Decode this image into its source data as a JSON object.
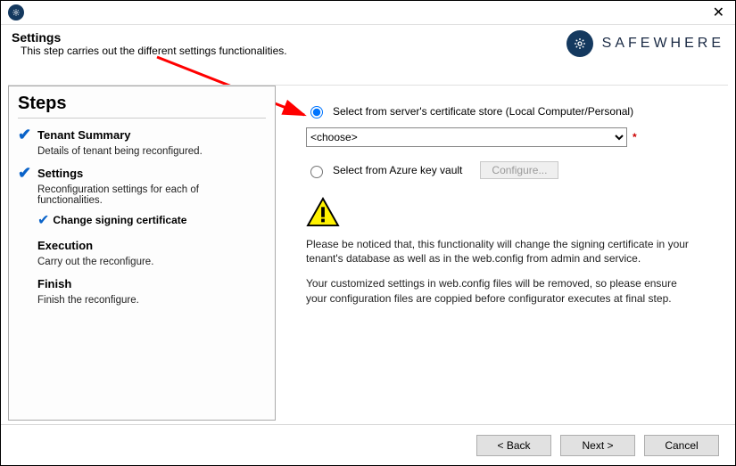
{
  "header": {
    "title": "Settings",
    "subtitle": "This step carries out the different settings functionalities.",
    "brand": "SAFEWHERE"
  },
  "sidebar": {
    "heading": "Steps",
    "steps": [
      {
        "title": "Tenant Summary",
        "desc": "Details of tenant being reconfigured.",
        "checked": true
      },
      {
        "title": "Settings",
        "desc": "Reconfiguration settings for each of functionalities.",
        "checked": true,
        "sub": "Change signing certificate"
      },
      {
        "title": "Execution",
        "desc": "Carry out the reconfigure.",
        "checked": false
      },
      {
        "title": "Finish",
        "desc": "Finish the reconfigure.",
        "checked": false
      }
    ]
  },
  "content": {
    "option_server": "Select from server's certificate store (Local Computer/Personal)",
    "option_azure": "Select from Azure key vault",
    "dropdown_value": "<choose>",
    "configure_button": "Configure...",
    "warning1": "Please be noticed that, this functionality will change the signing certificate in your tenant's database as well as in the web.config from admin and service.",
    "warning2": "Your customized settings in web.config files will be removed, so please ensure your configuration files are coppied before configurator executes at final step."
  },
  "footer": {
    "back": "< Back",
    "next": "Next >",
    "cancel": "Cancel"
  }
}
